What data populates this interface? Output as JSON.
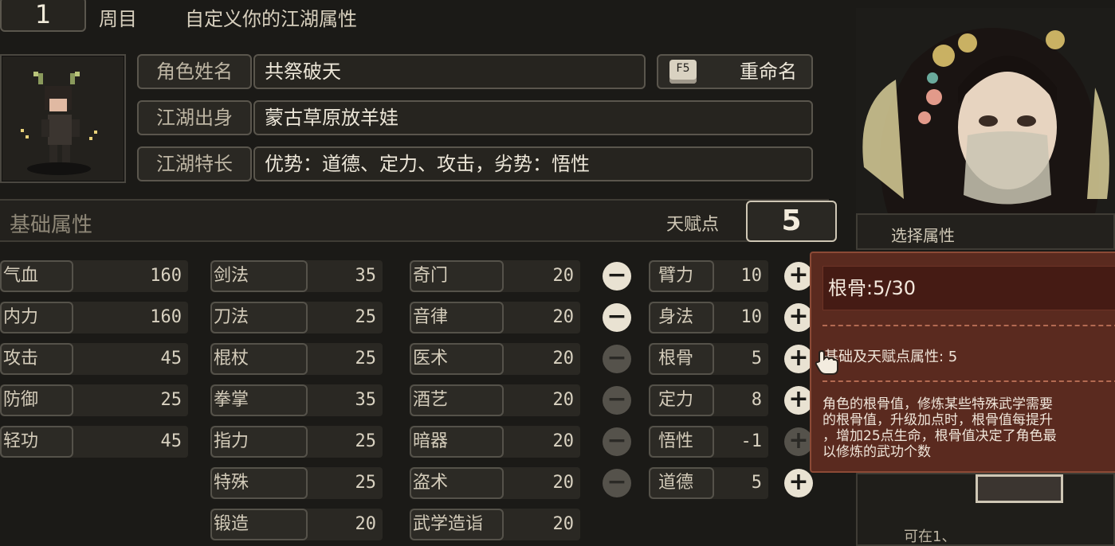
{
  "header": {
    "round_number": "1",
    "round_label": "周目",
    "subtitle": "自定义你的江湖属性"
  },
  "profile": {
    "name_label": "角色姓名",
    "name_value": "共祭破天",
    "rename_key": "F5",
    "rename_label": "重命名",
    "origin_label": "江湖出身",
    "origin_value": "蒙古草原放羊娃",
    "trait_label": "江湖特长",
    "trait_value": "优势：道德、定力、攻击，劣势：悟性"
  },
  "base": {
    "title": "基础属性",
    "talent_label": "天赋点",
    "talent_points": "5"
  },
  "stats_col1": [
    {
      "name": "气血",
      "value": "160"
    },
    {
      "name": "内力",
      "value": "160"
    },
    {
      "name": "攻击",
      "value": "45"
    },
    {
      "name": "防御",
      "value": "25"
    },
    {
      "name": "轻功",
      "value": "45"
    }
  ],
  "stats_col2": [
    {
      "name": "剑法",
      "value": "35"
    },
    {
      "name": "刀法",
      "value": "25"
    },
    {
      "name": "棍杖",
      "value": "25"
    },
    {
      "name": "拳掌",
      "value": "35"
    },
    {
      "name": "指力",
      "value": "25"
    },
    {
      "name": "特殊",
      "value": "25"
    },
    {
      "name": "锻造",
      "value": "20"
    }
  ],
  "stats_col3": [
    {
      "name": "奇门",
      "value": "20"
    },
    {
      "name": "音律",
      "value": "20"
    },
    {
      "name": "医术",
      "value": "20"
    },
    {
      "name": "酒艺",
      "value": "20"
    },
    {
      "name": "暗器",
      "value": "20"
    },
    {
      "name": "盗术",
      "value": "20"
    },
    {
      "name": "武学造诣",
      "value": "20"
    }
  ],
  "talents": [
    {
      "name": "臂力",
      "value": "10"
    },
    {
      "name": "身法",
      "value": "10"
    },
    {
      "name": "根骨",
      "value": "5"
    },
    {
      "name": "定力",
      "value": "8"
    },
    {
      "name": "悟性",
      "value": "-1"
    },
    {
      "name": "道德",
      "value": "5"
    }
  ],
  "right_panel": {
    "select_label": "选择属性",
    "bottom_text": "可在1、"
  },
  "tooltip": {
    "title": "根骨:5/30",
    "base_line": "基础及天赋点属性: 5",
    "desc_lines": [
      "角色的根骨值，修炼某些特殊武学需要",
      "的根骨值，升级加点时，根骨值每提升",
      "，增加25点生命，根骨值决定了角色最",
      "以修炼的武功个数"
    ]
  },
  "colors": {
    "tooltip_bg": "#5a2a1f",
    "background": "#1b1a17"
  }
}
